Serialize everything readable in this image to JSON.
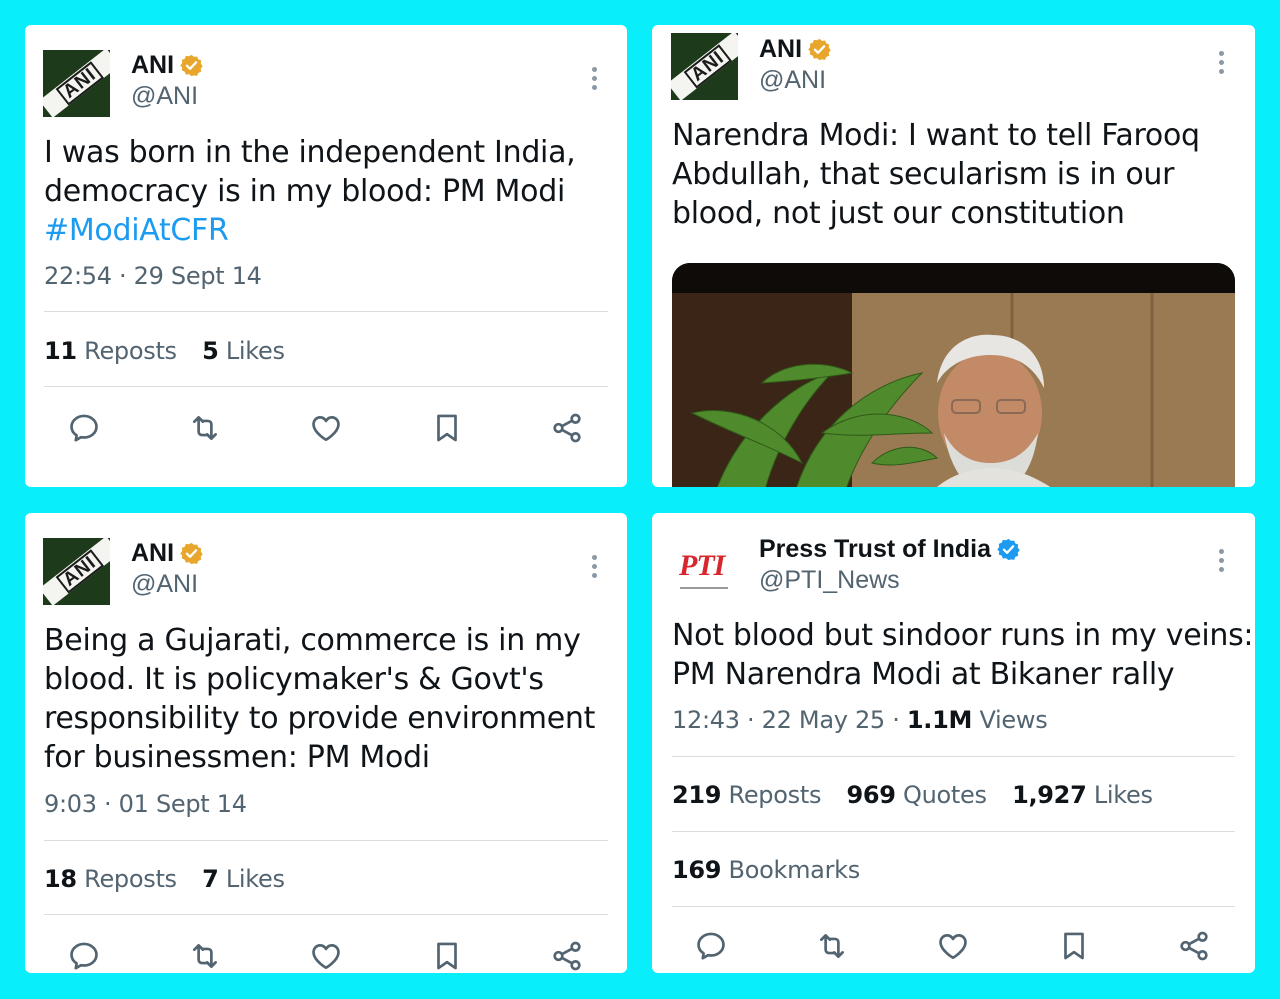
{
  "background_color": "#08eefa",
  "accent_color": "#1d9bf0",
  "gold_badge_color": "#e8a72c",
  "tweets": [
    {
      "author_name": "ANI",
      "handle": "@ANI",
      "avatar": "ani-logo",
      "badge": "gold-verified-badge",
      "text_lines": [
        "I was born in the independent India,",
        "democracy is in my blood: PM Modi"
      ],
      "hashtag": "#ModiAtCFR",
      "timestamp": "22:54 · 29 Sept 14",
      "reposts_count": "11",
      "reposts_label": "Reposts",
      "likes_count": "5",
      "likes_label": "Likes"
    },
    {
      "author_name": "ANI",
      "handle": "@ANI",
      "avatar": "ani-logo",
      "badge": "gold-verified-badge",
      "text_lines": [
        "Narendra Modi: I want to tell Farooq",
        "Abdullah, that secularism is in our",
        "blood, not just our constitution"
      ],
      "media": "video-thumbnail-photo"
    },
    {
      "author_name": "ANI",
      "handle": "@ANI",
      "avatar": "ani-logo",
      "badge": "gold-verified-badge",
      "text_lines": [
        "Being a Gujarati, commerce is in my",
        "blood. It is policymaker's & Govt's",
        "responsibility to provide environment",
        "for businessmen: PM Modi"
      ],
      "timestamp": "9:03 · 01 Sept 14",
      "reposts_count": "18",
      "reposts_label": "Reposts",
      "likes_count": "7",
      "likes_label": "Likes"
    },
    {
      "author_name": "Press Trust of India",
      "handle": "@PTI_News",
      "avatar": "pti-logo",
      "avatar_text": "PTI",
      "badge": "blue-verified-badge",
      "text_lines": [
        "Not blood but sindoor runs in my veins:",
        "PM Narendra Modi at Bikaner rally"
      ],
      "timestamp": "12:43 · 22 May 25 · ",
      "views_count": "1.1M",
      "views_label": "Views",
      "reposts_count": "219",
      "reposts_label": "Reposts",
      "quotes_count": "969",
      "quotes_label": "Quotes",
      "likes_count": "1,927",
      "likes_label": "Likes",
      "bookmarks_count": "169",
      "bookmarks_label": "Bookmarks"
    }
  ],
  "actions": [
    "reply-icon",
    "repost-icon",
    "like-icon",
    "bookmark-icon",
    "share-icon"
  ]
}
